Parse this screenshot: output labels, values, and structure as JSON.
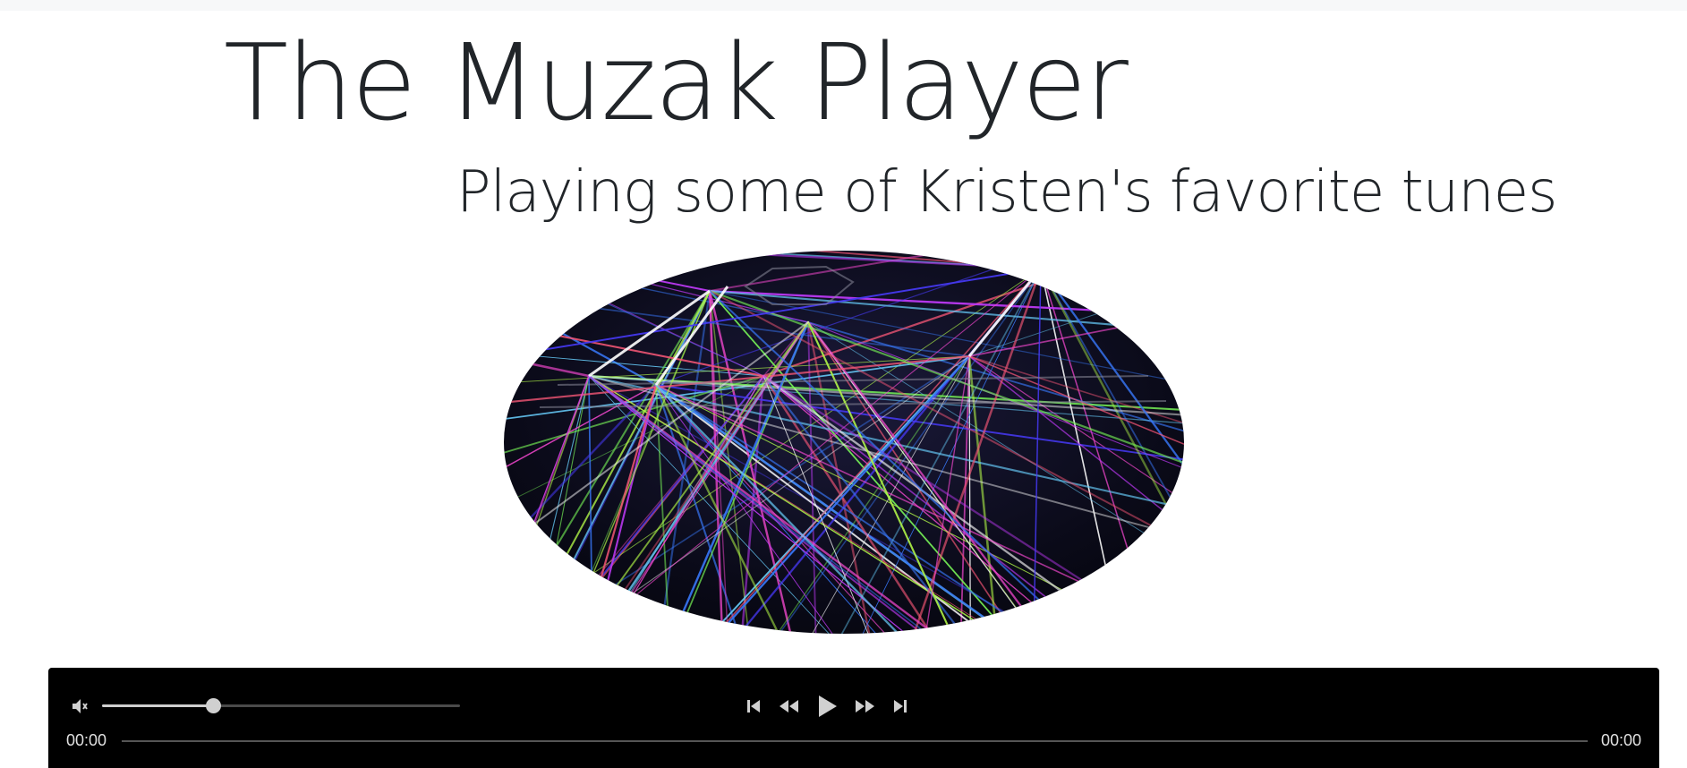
{
  "page": {
    "title": "The Muzak Player",
    "subtitle": "Playing some of Kristen's favorite tunes"
  },
  "artwork": {
    "icon": "laser-show-image"
  },
  "player": {
    "volume_fraction": 0.31,
    "progress_fraction": 0,
    "time_current": "00:00",
    "time_total": "00:00",
    "icons": {
      "volume": "speaker-icon",
      "previous": "skip-previous-icon",
      "rewind": "rewind-icon",
      "play": "play-icon",
      "forward": "fast-forward-icon",
      "next": "skip-next-icon"
    },
    "colors": {
      "bar_background": "#000000",
      "control": "#d0d0d0"
    }
  }
}
